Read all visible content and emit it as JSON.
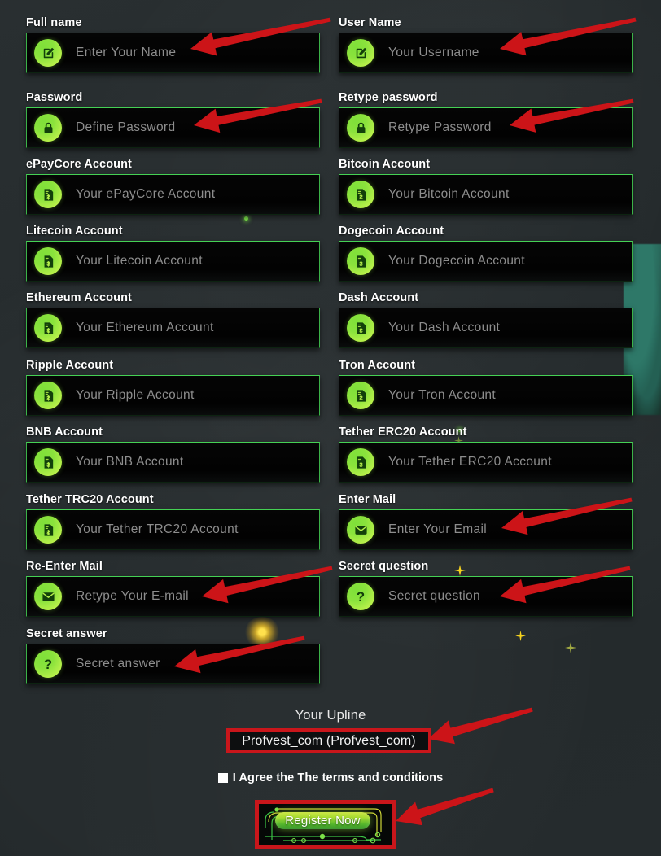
{
  "form": {
    "fields": [
      {
        "label": "Full name",
        "placeholder": "Enter Your Name",
        "icon": "edit-square-icon",
        "col": "left",
        "row": 0,
        "arrow": true
      },
      {
        "label": "User Name",
        "placeholder": "Your Username",
        "icon": "edit-square-icon",
        "col": "right",
        "row": 0,
        "arrow": true
      },
      {
        "label": "Password",
        "placeholder": "Define Password",
        "icon": "lock-icon",
        "col": "left",
        "row": 1,
        "arrow": true
      },
      {
        "label": "Retype password",
        "placeholder": "Retype Password",
        "icon": "lock-icon",
        "col": "right",
        "row": 1,
        "arrow": true
      },
      {
        "label": "ePayCore Account",
        "placeholder": "Your ePayCore Account",
        "icon": "invoice-dollar-icon",
        "col": "left",
        "row": 2,
        "arrow": false
      },
      {
        "label": "Bitcoin Account",
        "placeholder": "Your Bitcoin Account",
        "icon": "invoice-dollar-icon",
        "col": "right",
        "row": 2,
        "arrow": false
      },
      {
        "label": "Litecoin Account",
        "placeholder": "Your Litecoin Account",
        "icon": "invoice-dollar-icon",
        "col": "left",
        "row": 3,
        "arrow": false
      },
      {
        "label": "Dogecoin Account",
        "placeholder": "Your Dogecoin Account",
        "icon": "invoice-dollar-icon",
        "col": "right",
        "row": 3,
        "arrow": false
      },
      {
        "label": "Ethereum Account",
        "placeholder": "Your Ethereum Account",
        "icon": "invoice-dollar-icon",
        "col": "left",
        "row": 4,
        "arrow": false
      },
      {
        "label": "Dash Account",
        "placeholder": "Your Dash Account",
        "icon": "invoice-dollar-icon",
        "col": "right",
        "row": 4,
        "arrow": false
      },
      {
        "label": "Ripple Account",
        "placeholder": "Your Ripple Account",
        "icon": "invoice-dollar-icon",
        "col": "left",
        "row": 5,
        "arrow": false
      },
      {
        "label": "Tron Account",
        "placeholder": "Your Tron Account",
        "icon": "invoice-dollar-icon",
        "col": "right",
        "row": 5,
        "arrow": false
      },
      {
        "label": "BNB Account",
        "placeholder": "Your BNB Account",
        "icon": "invoice-dollar-icon",
        "col": "left",
        "row": 6,
        "arrow": false
      },
      {
        "label": "Tether ERC20 Account",
        "placeholder": "Your Tether ERC20 Account",
        "icon": "invoice-dollar-icon",
        "col": "right",
        "row": 6,
        "arrow": false
      },
      {
        "label": "Tether TRC20 Account",
        "placeholder": "Your Tether TRC20 Account",
        "icon": "invoice-dollar-icon",
        "col": "left",
        "row": 7,
        "arrow": false
      },
      {
        "label": "Enter Mail",
        "placeholder": "Enter Your Email",
        "icon": "envelope-icon",
        "col": "right",
        "row": 7,
        "arrow": true
      },
      {
        "label": "Re-Enter Mail",
        "placeholder": "Retype Your E-mail",
        "icon": "envelope-icon",
        "col": "left",
        "row": 8,
        "arrow": true
      },
      {
        "label": "Secret question",
        "placeholder": "Secret question",
        "icon": "question-mark-icon",
        "col": "right",
        "row": 8,
        "arrow": true
      },
      {
        "label": "Secret answer",
        "placeholder": "Secret answer",
        "icon": "question-mark-icon",
        "col": "left",
        "row": 9,
        "arrow": true
      }
    ]
  },
  "upline": {
    "title": "Your Upline",
    "value": "Profvest_com (Profvest_com)"
  },
  "terms": {
    "label": "I Agree the The terms and conditions",
    "checked": false
  },
  "submit": {
    "label": "Register Now"
  },
  "colors": {
    "accent_green": "#45d154",
    "icon_green": "#8ae23c",
    "annotation_red": "#c9161b",
    "background": "#23292b",
    "field_background": "#040404",
    "placeholder": "#8d8d8d",
    "label_text": "#ffffff"
  },
  "annotations": {
    "arrow_count": 9,
    "highlight_boxes": [
      "upline-value",
      "register-button"
    ]
  }
}
